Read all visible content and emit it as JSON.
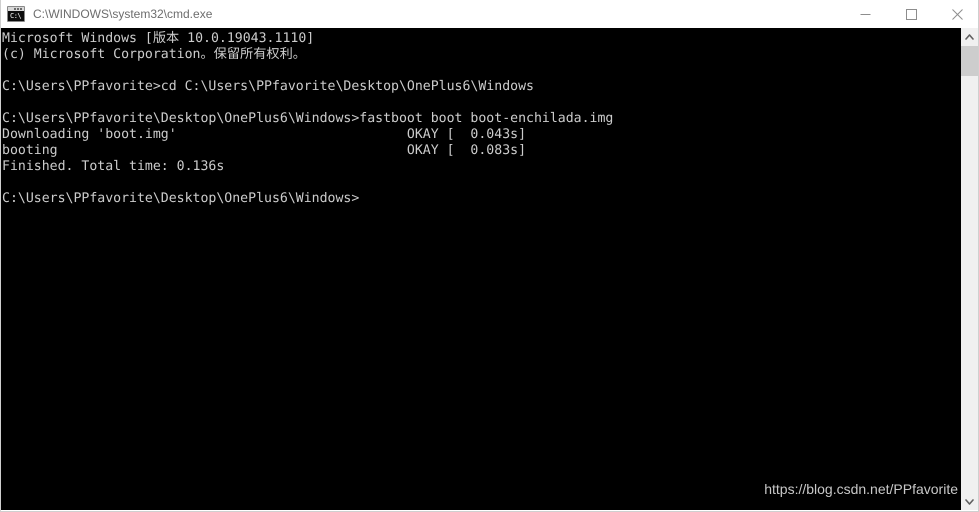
{
  "window": {
    "title": "C:\\WINDOWS\\system32\\cmd.exe",
    "icon": "cmd-icon",
    "icon_glyph": "C:\\",
    "controls": {
      "minimize_label": "Minimize",
      "maximize_label": "Maximize",
      "close_label": "Close"
    }
  },
  "console": {
    "background_color": "#000000",
    "text_color": "#cccccc",
    "lines": [
      "Microsoft Windows [版本 10.0.19043.1110]",
      "(c) Microsoft Corporation。保留所有权利。",
      "",
      "C:\\Users\\PPfavorite>cd C:\\Users\\PPfavorite\\Desktop\\OnePlus6\\Windows",
      "",
      "C:\\Users\\PPfavorite\\Desktop\\OnePlus6\\Windows>fastboot boot boot-enchilada.img",
      "Downloading 'boot.img'                             OKAY [  0.043s]",
      "booting                                            OKAY [  0.083s]",
      "Finished. Total time: 0.136s",
      "",
      "C:\\Users\\PPfavorite\\Desktop\\OnePlus6\\Windows>"
    ],
    "text": "Microsoft Windows [版本 10.0.19043.1110]\n(c) Microsoft Corporation。保留所有权利。\n\nC:\\Users\\PPfavorite>cd C:\\Users\\PPfavorite\\Desktop\\OnePlus6\\Windows\n\nC:\\Users\\PPfavorite\\Desktop\\OnePlus6\\Windows>fastboot boot boot-enchilada.img\nDownloading 'boot.img'                             OKAY [  0.043s]\nbooting                                            OKAY [  0.083s]\nFinished. Total time: 0.136s\n\nC:\\Users\\PPfavorite\\Desktop\\OnePlus6\\Windows>"
  },
  "watermark": {
    "text": "https://blog.csdn.net/PPfavorite"
  },
  "scrollbar": {
    "up_arrow": "chevron-up-icon",
    "down_arrow": "chevron-down-icon",
    "track_color": "#f0f0f0",
    "thumb_color": "#cdcdcd"
  }
}
